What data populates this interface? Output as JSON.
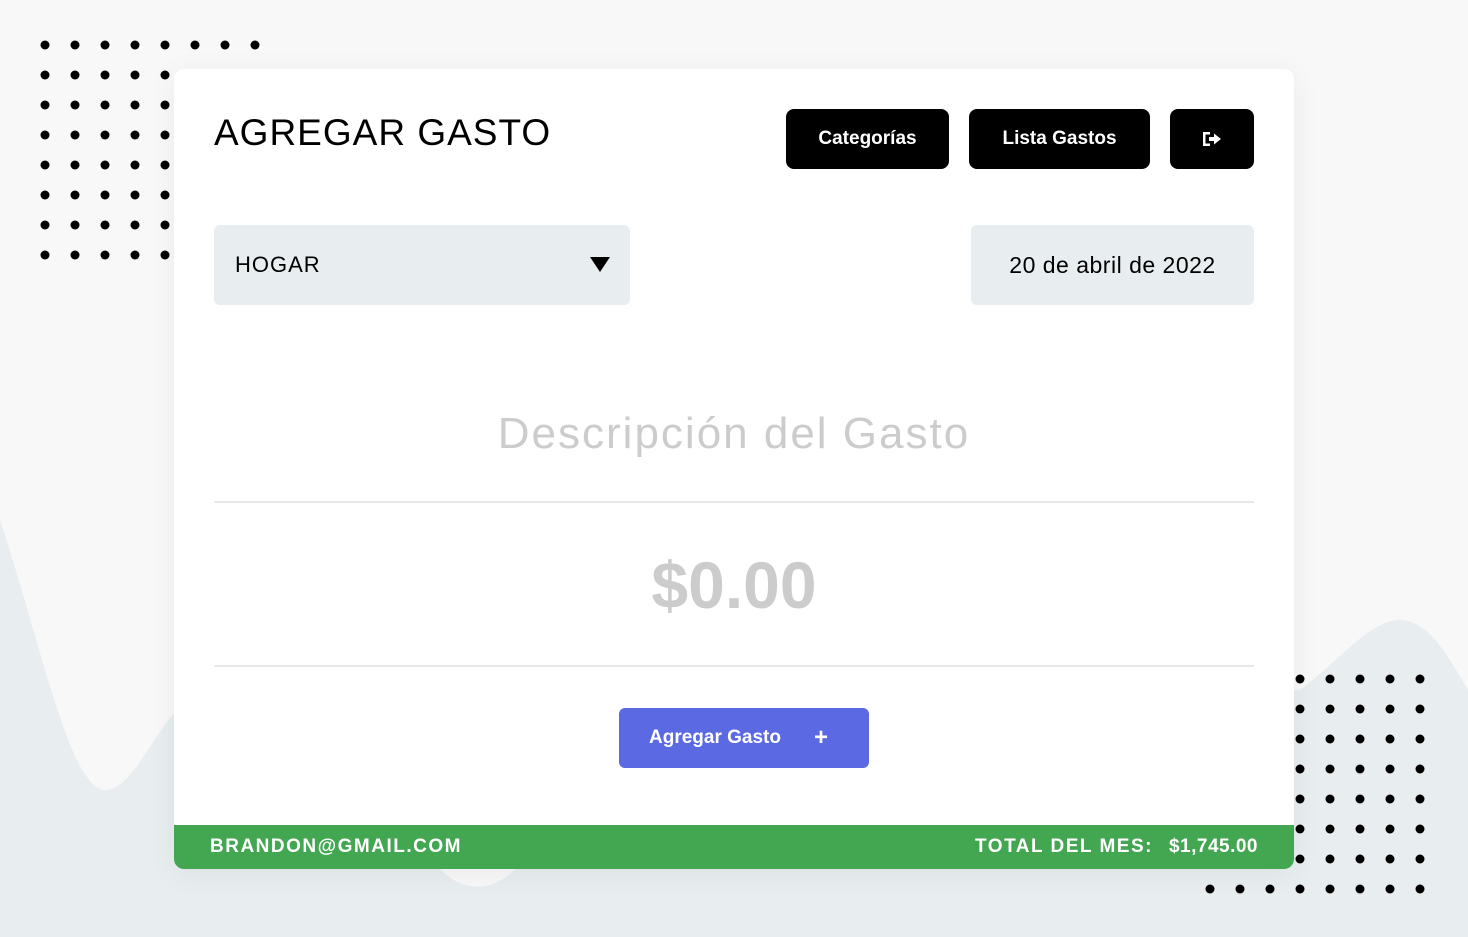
{
  "header": {
    "title": "AGREGAR GASTO",
    "categories_label": "Categorías",
    "list_label": "Lista Gastos",
    "logout_icon": "logout-icon"
  },
  "form": {
    "category_value": "HOGAR",
    "date_value": "20 de abril de 2022",
    "description_placeholder": "Descripción del Gasto",
    "amount_placeholder": "$0.00",
    "submit_label": "Agregar Gasto",
    "submit_icon": "plus-icon"
  },
  "footer": {
    "email": "BRANDON@GMAIL.COM",
    "total_label": "TOTAL DEL MES:",
    "total_value": "$1,745.00"
  },
  "colors": {
    "background": "#f8f8f8",
    "wave": "#e8eef0",
    "card": "#ffffff",
    "dark_button": "#000000",
    "field_bg": "#e8eef0",
    "placeholder": "#cccccc",
    "accent": "#5b69e2",
    "footer": "#43a752"
  }
}
